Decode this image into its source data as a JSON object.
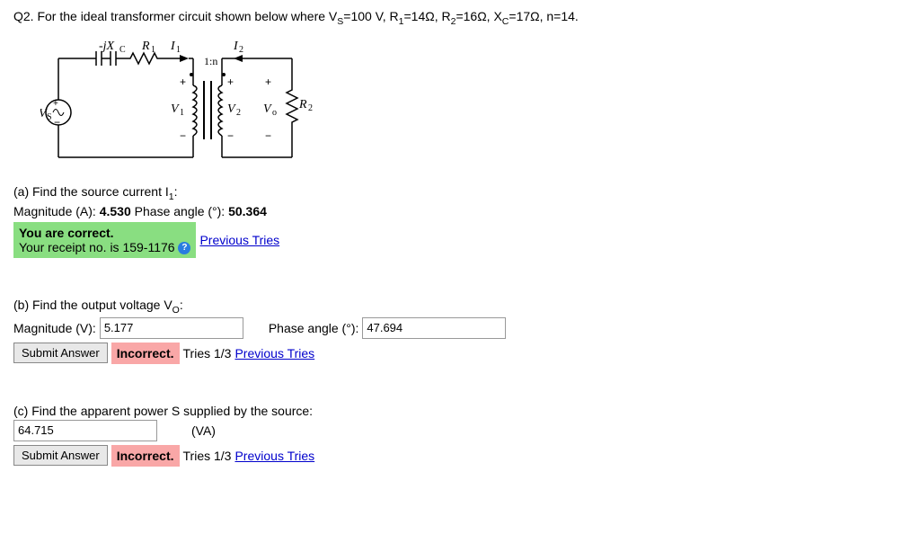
{
  "question": {
    "prefix": "Q2. For the ideal transformer circuit shown below where V",
    "sub_s": "S",
    "eq1": "=100 V, R",
    "sub_1": "1",
    "eq2": "=14Ω, R",
    "sub_2": "2",
    "eq3": "=16Ω, X",
    "sub_c": "C",
    "eq4": "=17Ω, n=14."
  },
  "circuit": {
    "minus_jxc": "-jX",
    "sub_c": "C",
    "r1": "R",
    "r1_sub": "1",
    "i1": "I",
    "i1_sub": "1",
    "i2": "I",
    "i2_sub": "2",
    "ratio": "1:n",
    "vs": "V",
    "vs_sub": "S",
    "v1": "V",
    "v1_sub": "1",
    "v2": "V",
    "v2_sub": "2",
    "vo": "V",
    "vo_sub": "o",
    "r2": "R",
    "r2_sub": "2"
  },
  "part_a": {
    "label_prefix": "(a) Find the source current I",
    "label_sub": "1",
    "label_suffix": ":",
    "mag_label": "Magnitude (A): ",
    "mag_value": "4.530",
    "phase_label": " Phase angle (°): ",
    "phase_value": "50.364",
    "correct_line1": "You are correct.",
    "correct_line2": "Your receipt no. is 159-1176",
    "prev_tries": "Previous Tries"
  },
  "part_b": {
    "label_prefix": "(b) Find the output voltage V",
    "label_sub": "O",
    "label_suffix": ":",
    "mag_label": "Magnitude (V):",
    "mag_value": "5.177",
    "phase_label": "Phase angle (°):",
    "phase_value": "47.694",
    "submit": "Submit Answer",
    "incorrect": "Incorrect.",
    "tries": "Tries 1/3",
    "prev_tries": "Previous Tries"
  },
  "part_c": {
    "label": "(c) Find the apparent power S supplied by the source:",
    "value": "64.715",
    "unit": "(VA)",
    "submit": "Submit Answer",
    "incorrect": "Incorrect.",
    "tries": "Tries 1/3",
    "prev_tries": "Previous Tries"
  }
}
